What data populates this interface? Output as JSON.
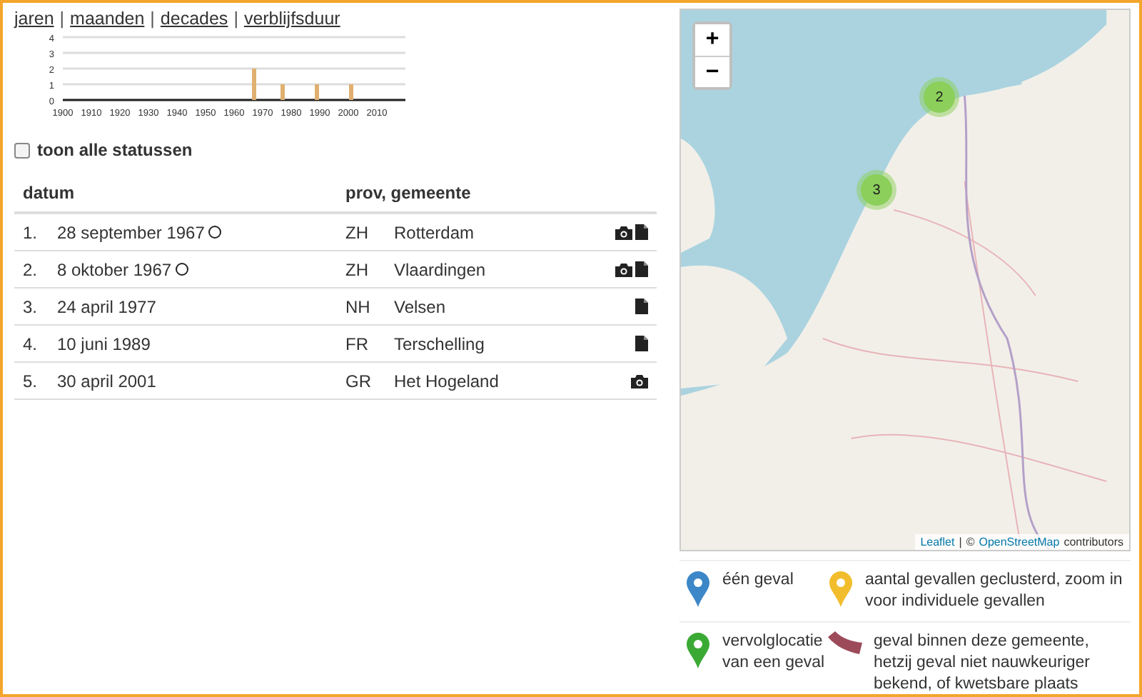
{
  "nav": {
    "links": [
      "jaren",
      "maanden",
      "decades",
      "verblijfsduur"
    ],
    "separator": "|"
  },
  "chart_data": {
    "type": "bar",
    "x": [
      1967,
      1977,
      1989,
      2001
    ],
    "values": [
      2,
      1,
      1,
      1
    ],
    "xlim": [
      1900,
      2020
    ],
    "ylim": [
      0,
      4
    ],
    "xticks": [
      1900,
      1910,
      1920,
      1930,
      1940,
      1950,
      1960,
      1970,
      1980,
      1990,
      2000,
      2010
    ],
    "yticks": [
      0,
      1,
      2,
      3,
      4
    ],
    "grid": true
  },
  "filter": {
    "label": "toon alle statussen",
    "checked": false
  },
  "table": {
    "columns": [
      "datum",
      "prov, gemeente"
    ],
    "rows": [
      {
        "num": "1.",
        "date": "28 september 1967",
        "ring": true,
        "prov": "ZH",
        "gemeente": "Rotterdam",
        "photo": true,
        "document": true
      },
      {
        "num": "2.",
        "date": "8 oktober 1967",
        "ring": true,
        "prov": "ZH",
        "gemeente": "Vlaardingen",
        "photo": true,
        "document": true
      },
      {
        "num": "3.",
        "date": "24 april 1977",
        "ring": false,
        "prov": "NH",
        "gemeente": "Velsen",
        "photo": false,
        "document": true
      },
      {
        "num": "4.",
        "date": "10 juni 1989",
        "ring": false,
        "prov": "FR",
        "gemeente": "Terschelling",
        "photo": false,
        "document": true
      },
      {
        "num": "5.",
        "date": "30 april 2001",
        "ring": false,
        "prov": "GR",
        "gemeente": "Het Hogeland",
        "photo": true,
        "document": false
      }
    ]
  },
  "map": {
    "zoom_in": "+",
    "zoom_out": "−",
    "clusters": [
      {
        "count": "2"
      },
      {
        "count": "3"
      }
    ],
    "attribution": {
      "link1": "Leaflet",
      "separator": "|",
      "prefix": "©",
      "link2": "OpenStreetMap",
      "suffix": "contributors"
    }
  },
  "legend": [
    {
      "kind": "pin",
      "color": "#3b87c8",
      "text": "één geval"
    },
    {
      "kind": "pin",
      "color": "#f2bd2c",
      "text": "aantal gevallen geclusterd, zoom in voor individuele gevallen"
    },
    {
      "kind": "pin",
      "color": "#3aaa35",
      "text": "vervolglocatie van een geval"
    },
    {
      "kind": "area",
      "color": "#9c4a5a",
      "text": "geval binnen deze gemeente, hetzij geval niet nauwkeuriger bekend, of kwetsbare plaats"
    }
  ]
}
